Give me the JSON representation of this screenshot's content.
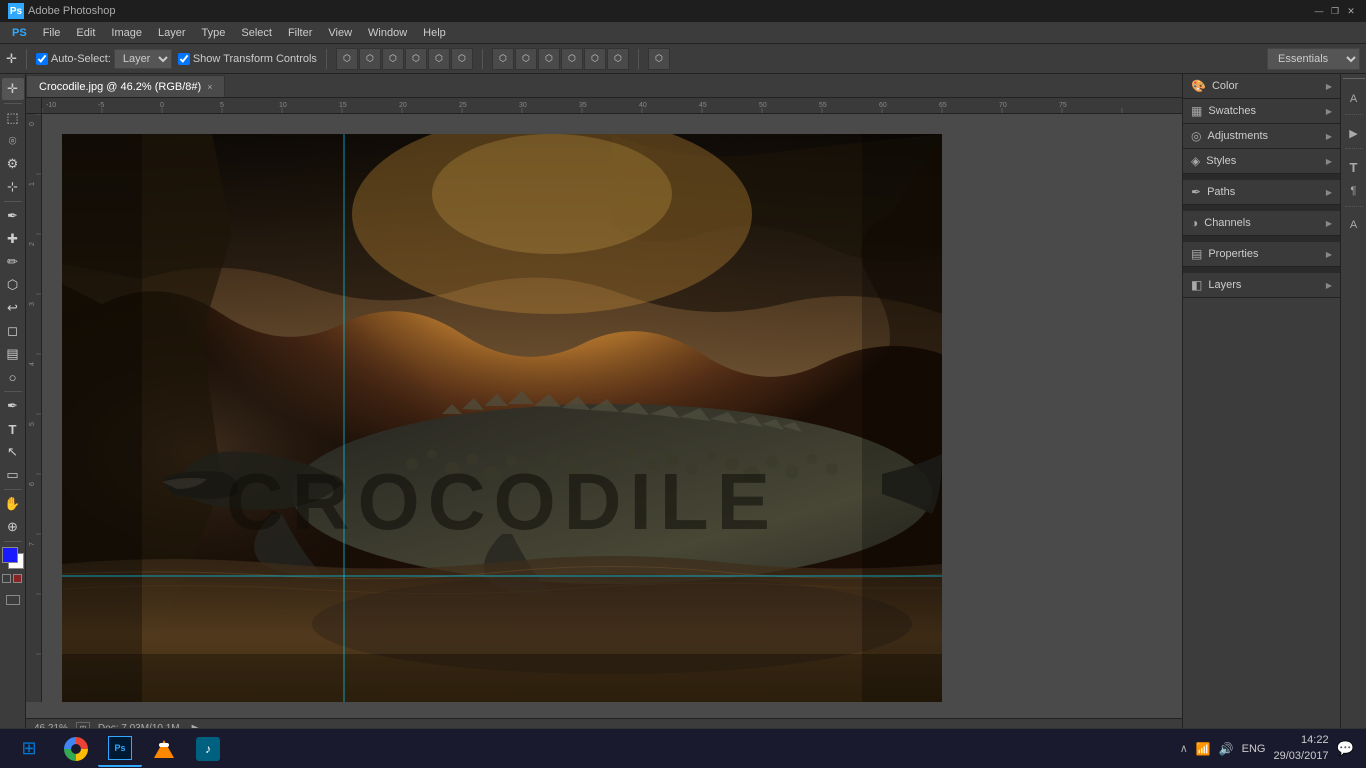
{
  "titlebar": {
    "app_name": "Adobe Photoshop",
    "win_controls": [
      "—",
      "❐",
      "✕"
    ]
  },
  "menubar": {
    "items": [
      "PS",
      "File",
      "Edit",
      "Image",
      "Layer",
      "Type",
      "Select",
      "Filter",
      "View",
      "Window",
      "Help"
    ]
  },
  "optionsbar": {
    "auto_select_label": "Auto-Select:",
    "layer_select": "Layer",
    "show_transform_label": "Show Transform Controls",
    "workspace_label": "Essentials"
  },
  "tab": {
    "name": "Crocodile.jpg @ 46.2% (RGB/8#)",
    "close": "×"
  },
  "canvas": {
    "zoom_text": "46.21%",
    "doc_info": "Doc: 7.03M/10.1M"
  },
  "right_panel": {
    "groups": [
      {
        "id": "color",
        "label": "Color",
        "icon": "🎨"
      },
      {
        "id": "swatches",
        "label": "Swatches",
        "icon": "▦"
      },
      {
        "id": "adjustments",
        "label": "Adjustments",
        "icon": "◎"
      },
      {
        "id": "styles",
        "label": "Styles",
        "icon": "◈"
      },
      {
        "id": "paths",
        "label": "Paths",
        "icon": "✒"
      },
      {
        "id": "channels",
        "label": "Channels",
        "icon": "◑"
      },
      {
        "id": "properties",
        "label": "Properties",
        "icon": "▤"
      },
      {
        "id": "layers",
        "label": "Layers",
        "icon": "◧"
      }
    ]
  },
  "panel_icons": {
    "items": [
      "A",
      "¶",
      "T",
      "A",
      "◈",
      "≡"
    ]
  },
  "toolbar": {
    "tools": [
      {
        "id": "move",
        "icon": "✛",
        "label": "Move Tool"
      },
      {
        "id": "marquee",
        "icon": "⬚",
        "label": "Marquee Tool"
      },
      {
        "id": "lasso",
        "icon": "⌾",
        "label": "Lasso Tool"
      },
      {
        "id": "quickselect",
        "icon": "⚙",
        "label": "Quick Selection"
      },
      {
        "id": "crop",
        "icon": "⊹",
        "label": "Crop Tool"
      },
      {
        "id": "eyedropper",
        "icon": "✒",
        "label": "Eyedropper"
      },
      {
        "id": "healing",
        "icon": "✚",
        "label": "Healing Brush"
      },
      {
        "id": "brush",
        "icon": "✏",
        "label": "Brush Tool"
      },
      {
        "id": "stamp",
        "icon": "⬡",
        "label": "Clone Stamp"
      },
      {
        "id": "history",
        "icon": "↩",
        "label": "History Brush"
      },
      {
        "id": "eraser",
        "icon": "◻",
        "label": "Eraser"
      },
      {
        "id": "gradient",
        "icon": "▤",
        "label": "Gradient Tool"
      },
      {
        "id": "dodge",
        "icon": "○",
        "label": "Dodge Tool"
      },
      {
        "id": "pen",
        "icon": "✒",
        "label": "Pen Tool"
      },
      {
        "id": "type",
        "icon": "T",
        "label": "Type Tool"
      },
      {
        "id": "path-select",
        "icon": "↖",
        "label": "Path Selection"
      },
      {
        "id": "shape",
        "icon": "▭",
        "label": "Shape Tool"
      },
      {
        "id": "hand",
        "icon": "✋",
        "label": "Hand Tool"
      },
      {
        "id": "zoom",
        "icon": "⊕",
        "label": "Zoom Tool"
      }
    ]
  },
  "taskbar": {
    "start_icon": "⊞",
    "apps": [
      {
        "id": "chrome",
        "label": "Chrome",
        "icon": "●",
        "color": "#4285f4"
      },
      {
        "id": "photoshop",
        "label": "Photoshop",
        "icon": "Ps",
        "color": "#31a8ff",
        "active": true
      },
      {
        "id": "vlc",
        "label": "VLC",
        "icon": "▶",
        "color": "#ff8800"
      },
      {
        "id": "media",
        "label": "Media",
        "icon": "♪",
        "color": "#00bcd4"
      }
    ],
    "system_tray": {
      "icons": [
        "∧",
        "📶",
        "🔊"
      ],
      "language": "ENG",
      "time": "14:22",
      "date": "29/03/2017",
      "notification": "💬"
    }
  },
  "guide_lines": {
    "vertical": [
      {
        "left_percent": 32
      }
    ],
    "horizontal": [
      {
        "top_percent": 76
      }
    ]
  },
  "crocodile_text": "CROCODILE"
}
